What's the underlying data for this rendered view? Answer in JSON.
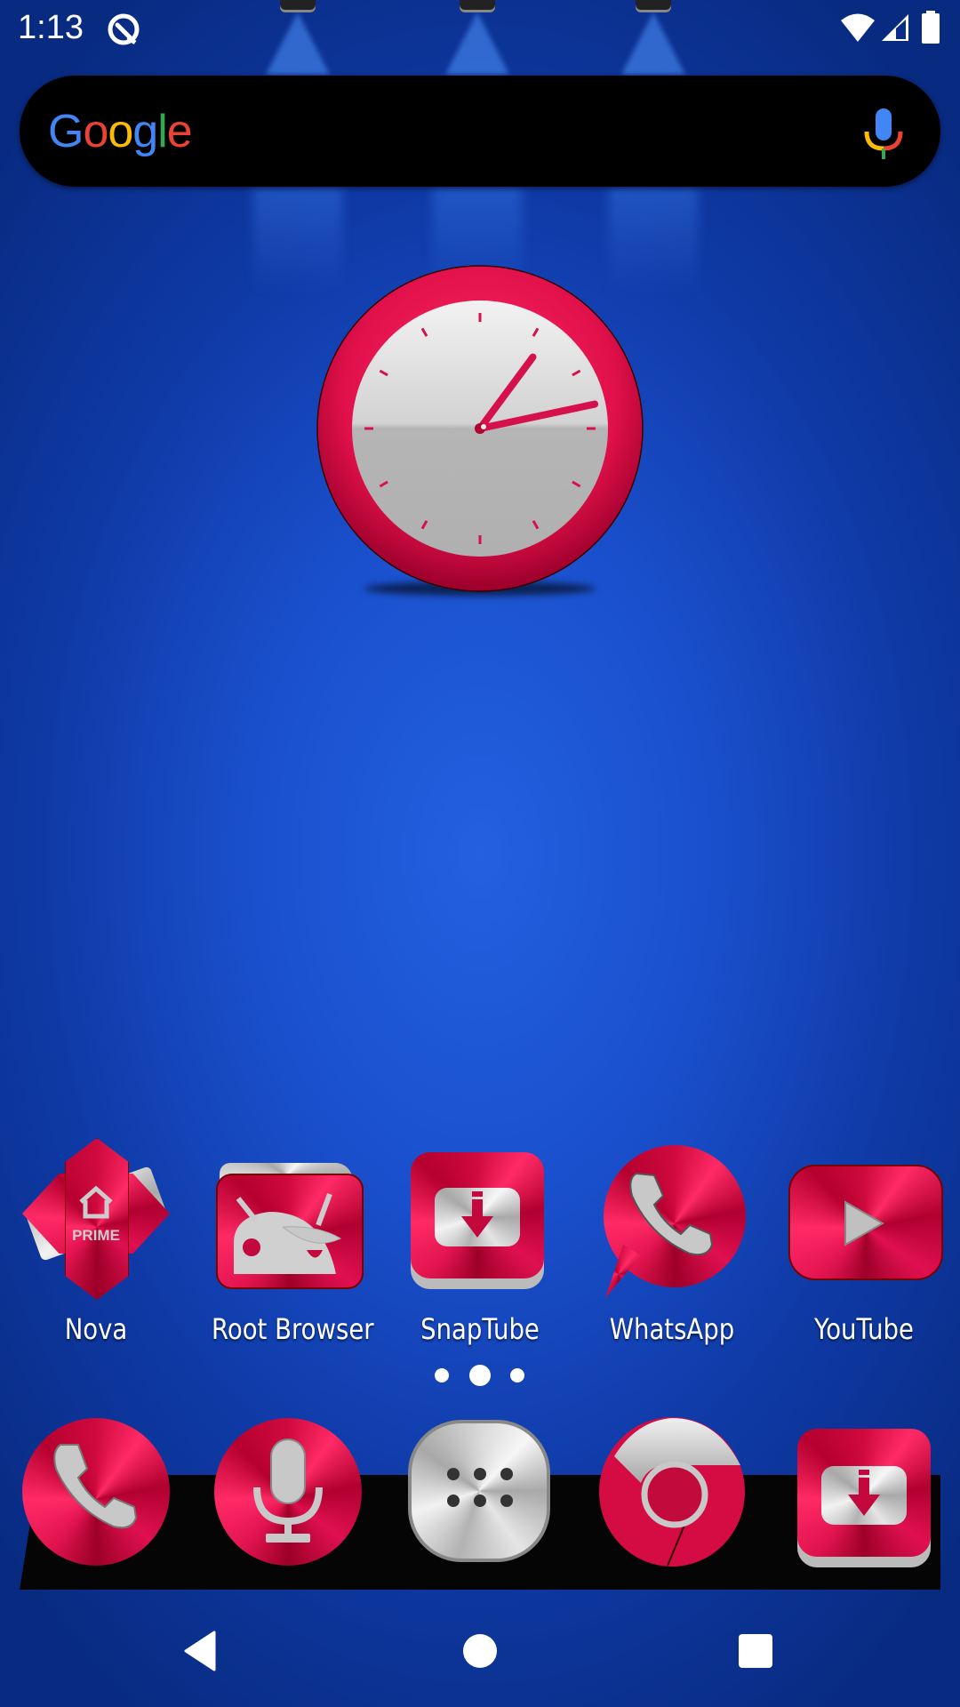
{
  "status_bar": {
    "time": "1:13",
    "left_icons": [
      "q-notification-icon"
    ],
    "right_icons": [
      "wifi-icon",
      "cellular-signal-icon",
      "battery-icon"
    ]
  },
  "search_widget": {
    "logo_letters": [
      {
        "char": "G",
        "color": "#4285F4"
      },
      {
        "char": "o",
        "color": "#EA4335"
      },
      {
        "char": "o",
        "color": "#FBBC05"
      },
      {
        "char": "g",
        "color": "#4285F4"
      },
      {
        "char": "l",
        "color": "#34A853"
      },
      {
        "char": "e",
        "color": "#EA4335"
      }
    ],
    "mic_icon": "microphone-icon"
  },
  "clock_widget": {
    "type": "analog",
    "hour": 1,
    "minute": 13,
    "accent_color": "#e0104a"
  },
  "home_apps": [
    {
      "label": "Nova",
      "icon": "nova-prime-icon"
    },
    {
      "label": "Root Browser",
      "icon": "root-browser-icon"
    },
    {
      "label": "SnapTube",
      "icon": "snaptube-icon"
    },
    {
      "label": "WhatsApp",
      "icon": "whatsapp-icon"
    },
    {
      "label": "YouTube",
      "icon": "youtube-icon"
    }
  ],
  "page_indicator": {
    "count": 3,
    "active_index": 1
  },
  "dock": [
    {
      "name": "Phone",
      "icon": "phone-icon"
    },
    {
      "name": "Voice Search",
      "icon": "voice-search-icon"
    },
    {
      "name": "App Drawer",
      "icon": "app-drawer-icon"
    },
    {
      "name": "Chrome",
      "icon": "chrome-icon"
    },
    {
      "name": "SnapTube",
      "icon": "snaptube-icon"
    }
  ],
  "nav_bar": {
    "back": "back-icon",
    "home": "home-icon",
    "recents": "recents-icon"
  },
  "theme": {
    "icon_red": "#e0104a",
    "icon_silver": "#c8c8c8",
    "wallpaper_blue": "#1a4fcc"
  }
}
